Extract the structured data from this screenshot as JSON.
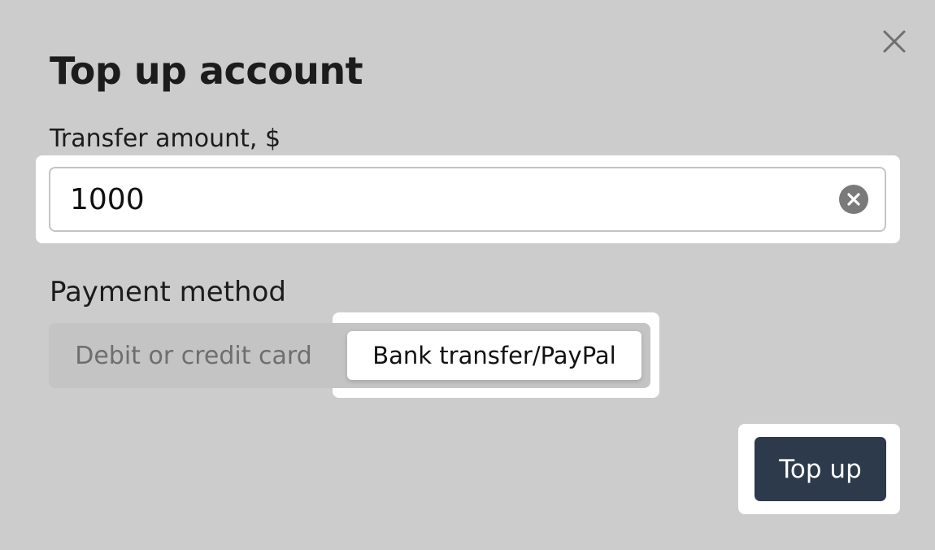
{
  "dialog": {
    "title": "Top up account",
    "close_icon": "close-icon"
  },
  "amount": {
    "label": "Transfer amount, $",
    "value": "1000",
    "clear_icon": "clear-circle-icon"
  },
  "payment": {
    "label": "Payment method",
    "options": [
      {
        "label": "Debit or credit card",
        "selected": false
      },
      {
        "label": "Bank transfer/PayPal",
        "selected": true
      }
    ]
  },
  "actions": {
    "submit_label": "Top up"
  },
  "colors": {
    "overlay_background": "#cccccc",
    "primary_button": "#2d3a4b",
    "highlight": "#ffffff",
    "segment_background": "#c4c4c4"
  }
}
